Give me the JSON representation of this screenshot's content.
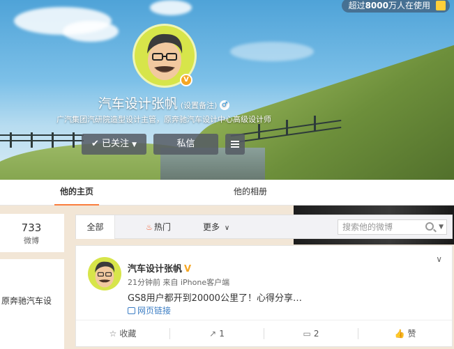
{
  "header": {
    "badge_prefix": "超过",
    "badge_count": "8000",
    "badge_suffix": "万人在使用"
  },
  "profile": {
    "name": "汽车设计张帆",
    "remark": "(设置备注)",
    "gender_icon": "male-icon",
    "description": "广汽集团汽研院造型设计主管，原奔驰汽车设计中心高级设计师",
    "follow_button": "已关注",
    "message_button": "私信",
    "verified_badge": "V"
  },
  "tabs": [
    {
      "label": "他的主页"
    },
    {
      "label": "他的相册"
    }
  ],
  "left": {
    "stat_value": "733",
    "stat_label": "微博",
    "snippet": "原奔驰汽车设"
  },
  "filter": {
    "all": "全部",
    "hot": "热门",
    "more": "更多",
    "search_placeholder": "搜索他的微博"
  },
  "post": {
    "author": "汽车设计张帆",
    "verified": "V",
    "meta": "21分钟前 来自 iPhone客户端",
    "text": "GS8用户都开到20000公里了！心得分享…",
    "link": "网页链接",
    "actions": {
      "favorite": "收藏",
      "repost": "1",
      "comment": "2",
      "like": "赞"
    }
  },
  "colors": {
    "accent": "#fa7d3c",
    "link": "#3b7dc4",
    "verified": "#f5a623"
  }
}
